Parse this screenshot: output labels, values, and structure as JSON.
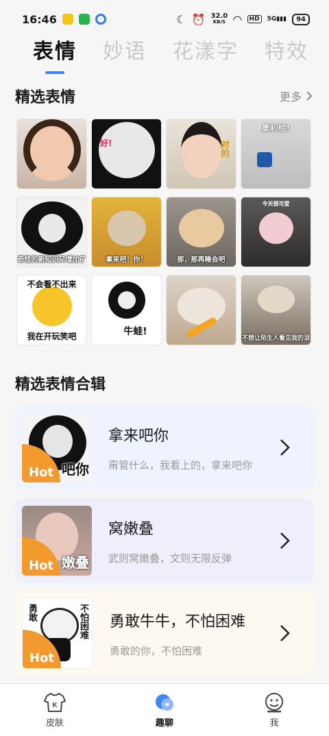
{
  "status": {
    "time": "16:46",
    "net_speed": "32.0",
    "net_unit": "KB/S",
    "hd": "HD",
    "signal_label": "5G",
    "battery": "94"
  },
  "tabs": [
    {
      "label": "表情",
      "active": true
    },
    {
      "label": "妙语",
      "active": false
    },
    {
      "label": "花漾字",
      "active": false
    },
    {
      "label": "特效",
      "active": false
    }
  ],
  "featured": {
    "title": "精选表情",
    "more_label": "更多",
    "stickers": [
      {
        "caption": "",
        "topcap": ""
      },
      {
        "caption": "",
        "topcap": "好!"
      },
      {
        "caption": "",
        "topcap": "对的"
      },
      {
        "caption": "",
        "topcap": "奥利给!"
      },
      {
        "caption": "奇怪的新知识又增加了",
        "topcap": ""
      },
      {
        "caption": "拿来吧！你！",
        "topcap": ""
      },
      {
        "caption": "那，那再睡会吧",
        "topcap": ""
      },
      {
        "caption": "",
        "topcap": "今天很可爱"
      },
      {
        "caption": "我在开玩笑吧",
        "topcap": "不会看不出来"
      },
      {
        "caption": "牛蛙!",
        "topcap": ""
      },
      {
        "caption": "",
        "topcap": ""
      },
      {
        "caption": "不想让陌生人看见我的泪",
        "topcap": ""
      }
    ]
  },
  "collections": {
    "title": "精选表情合辑",
    "hot_label": "Hot",
    "items": [
      {
        "title": "拿来吧你",
        "subtitle": "甭管什么，我看上的，拿来吧你",
        "thumb_caption": "吧你",
        "bg": "#eef3fd"
      },
      {
        "title": "窝嫩叠",
        "subtitle": "武则窝嫩叠，文则无限反弹",
        "thumb_caption": "嫩叠",
        "bg": "#efeefb"
      },
      {
        "title": "勇敢牛牛，不怕困难",
        "subtitle": "勇敢的你，不怕困难",
        "thumb_caption": "",
        "bg": "#fdf8f0"
      }
    ]
  },
  "bottom_nav": [
    {
      "label": "皮肤",
      "active": false
    },
    {
      "label": "趣聊",
      "active": true
    },
    {
      "label": "我",
      "active": false
    }
  ],
  "colors": {
    "accent": "#3f86f7",
    "hot": "#f29a2e"
  }
}
